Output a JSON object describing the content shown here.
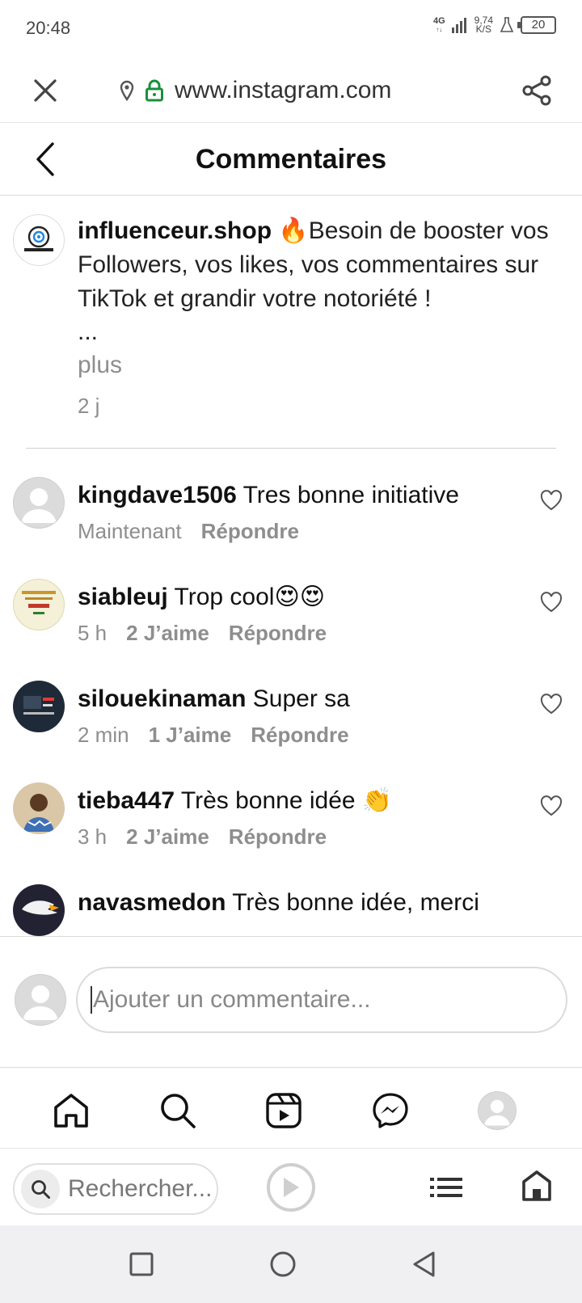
{
  "status_bar": {
    "time": "20:48",
    "network": "4G",
    "speed_value": "9,74",
    "speed_unit": "K/S",
    "battery": "20"
  },
  "browser": {
    "url": "www.instagram.com"
  },
  "header": {
    "title": "Commentaires"
  },
  "caption": {
    "username": "influenceur.shop",
    "emoji": "🔥",
    "text": "Besoin de booster vos Followers, vos likes, vos commentaires sur TikTok et grandir votre notoriété !",
    "ellipsis": "...",
    "more_label": "plus",
    "time": "2 j"
  },
  "comments": [
    {
      "username": "kingdave1506",
      "text": "Tres bonne initiative",
      "time": "Maintenant",
      "likes": "",
      "reply_label": "Répondre"
    },
    {
      "username": "siableuj",
      "text": "Trop cool😍😍",
      "time": "5 h",
      "likes": "2 J’aime",
      "reply_label": "Répondre"
    },
    {
      "username": "silouekinaman",
      "text": "Super sa",
      "time": "2 min",
      "likes": "1 J’aime",
      "reply_label": "Répondre"
    },
    {
      "username": "tieba447",
      "text": "Très bonne idée 👏",
      "time": "3 h",
      "likes": "2 J’aime",
      "reply_label": "Répondre"
    },
    {
      "username": "navasmedon",
      "text": "Très bonne idée, merci",
      "time": "",
      "likes": "",
      "reply_label": ""
    }
  ],
  "comment_input": {
    "placeholder": "Ajouter un commentaire..."
  },
  "ig_nav": [
    "home-icon",
    "search-icon",
    "reels-icon",
    "messenger-icon",
    "profile-icon"
  ],
  "browser_nav": {
    "search_placeholder": "Rechercher..."
  },
  "colors": {
    "secure_lock": "#1a8f3c",
    "muted_text": "#8e8e8e",
    "divider": "#dbdbdb"
  }
}
